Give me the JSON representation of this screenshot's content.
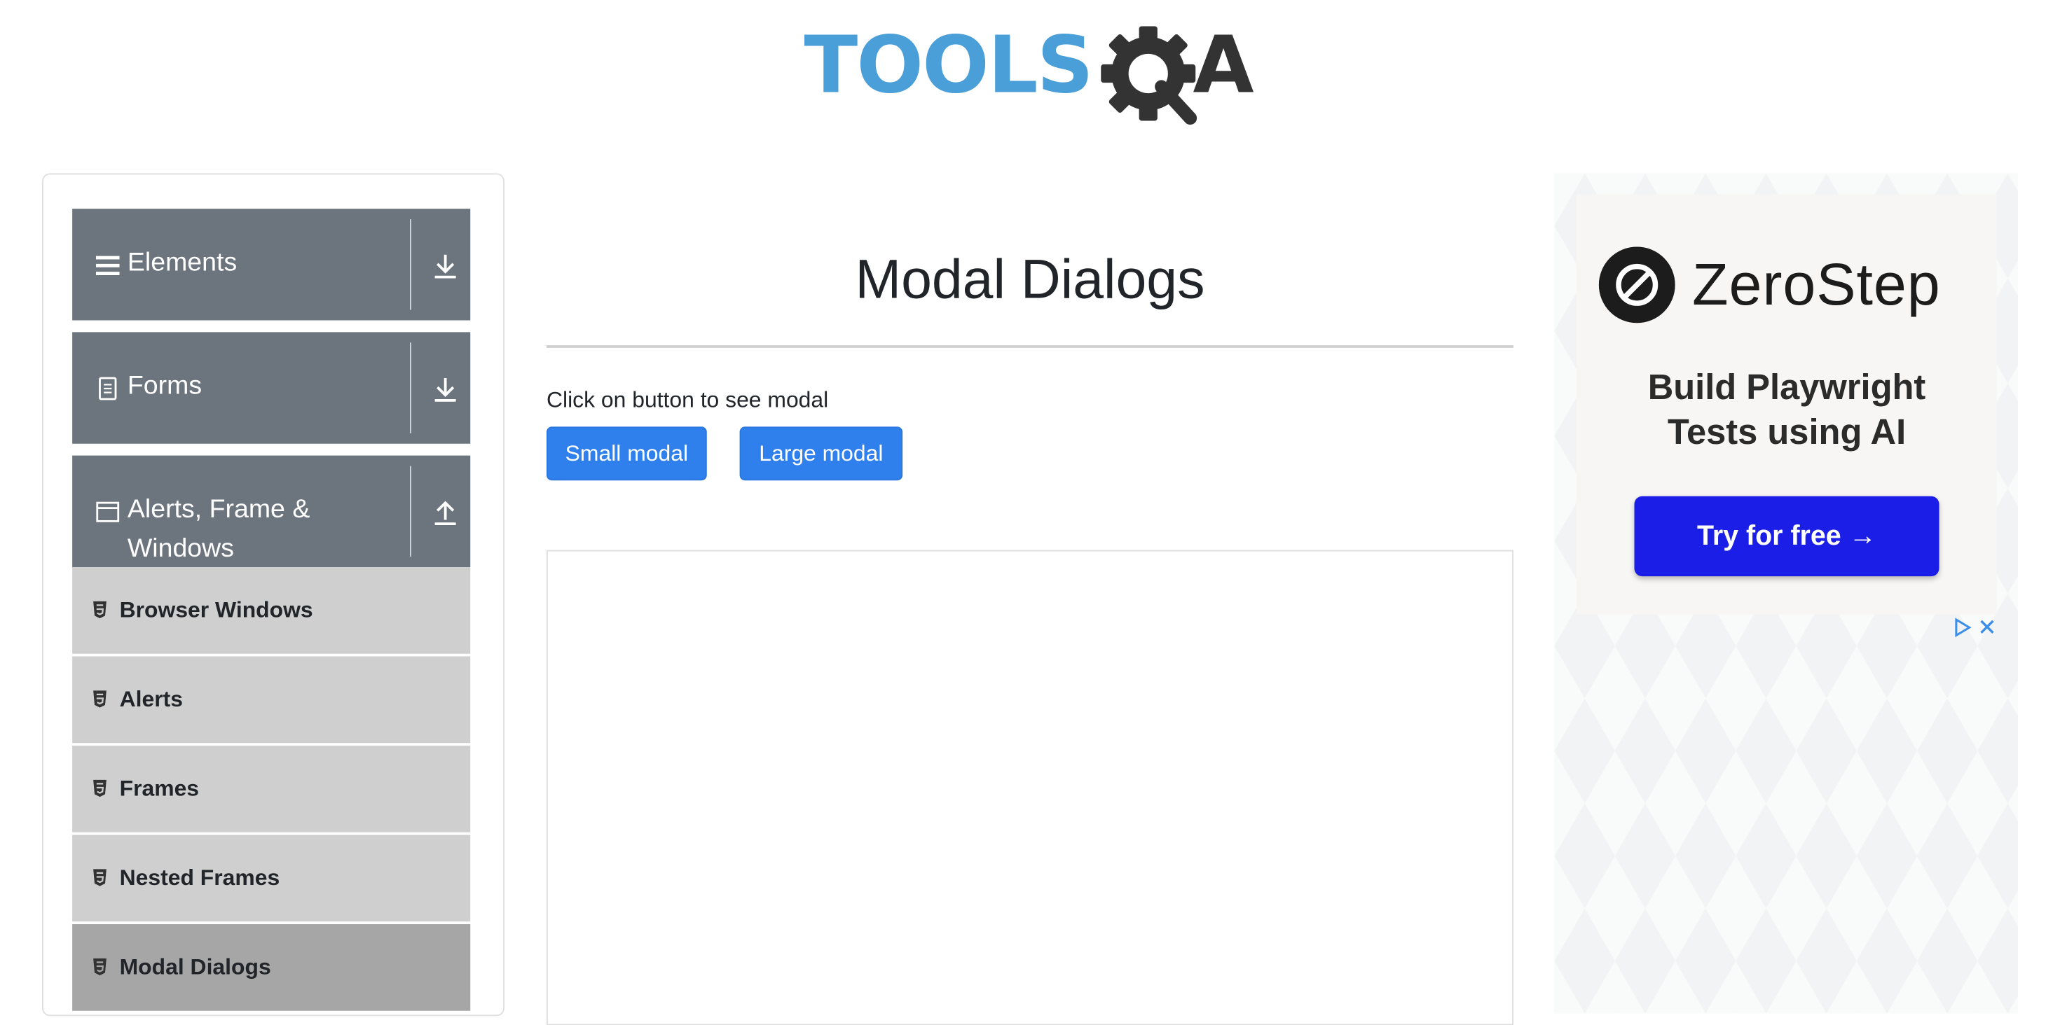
{
  "header": {
    "logo_text": "TOOLS",
    "logo_suffix": "A",
    "logo_name": "TOOLSQA"
  },
  "sidebar": {
    "groups": [
      {
        "label": "Elements",
        "icon": "hamburger-icon",
        "state": "collapsed"
      },
      {
        "label": "Forms",
        "icon": "document-icon",
        "state": "collapsed"
      },
      {
        "label": "Alerts, Frame &",
        "label_line2": "Windows",
        "icon": "window-icon",
        "state": "expanded"
      }
    ],
    "items": [
      {
        "label": "Browser Windows",
        "active": false
      },
      {
        "label": "Alerts",
        "active": false
      },
      {
        "label": "Frames",
        "active": false
      },
      {
        "label": "Nested Frames",
        "active": false
      },
      {
        "label": "Modal Dialogs",
        "active": true
      }
    ]
  },
  "main": {
    "title": "Modal Dialogs",
    "prompt": "Click on button to see modal",
    "buttons": {
      "small": "Small modal",
      "large": "Large modal"
    }
  },
  "ad": {
    "brand": "ZeroStep",
    "tagline_line1": "Build Playwright",
    "tagline_line2": "Tests using AI",
    "cta": "Try for free →"
  },
  "colors": {
    "group_header": "#6c757d",
    "menu_item": "#cfcfcf",
    "menu_item_active": "#a6a6a6",
    "primary_button": "#2f80ed",
    "logo_blue": "#4a9fd8",
    "ad_cta": "#1a1ee6"
  }
}
